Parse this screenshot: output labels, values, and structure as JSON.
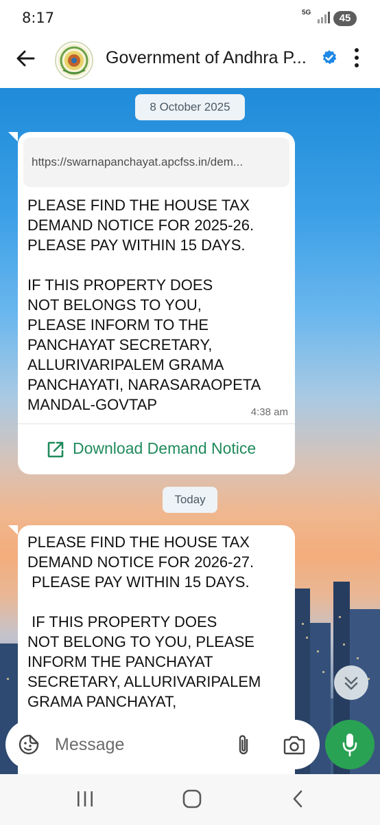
{
  "status_bar": {
    "time": "8:17",
    "network": "5G",
    "battery": "45"
  },
  "header": {
    "title": "Government of Andhra P...",
    "back_icon": "arrow-left-icon",
    "verified_icon": "verified-badge-icon",
    "menu_icon": "more-vertical-icon"
  },
  "messages": [
    {
      "date_chip": "8 October 2025",
      "link": "https://swarnapanchayat.apcfss.in/dem...",
      "text": "PLEASE FIND THE HOUSE TAX\nDEMAND NOTICE FOR 2025-26.\nPLEASE PAY WITHIN 15 DAYS.\n\nIF THIS PROPERTY DOES\nNOT BELONGS TO YOU,\nPLEASE INFORM TO THE\nPANCHAYAT SECRETARY,\nALLURIVARIPALEM GRAMA\nPANCHAYATI, NARASARAOPETA\nMANDAL-GOVTAP",
      "time": "4:38 am",
      "action_label": "Download Demand Notice",
      "action_icon": "external-link-icon"
    },
    {
      "date_chip": "Today",
      "text": "PLEASE FIND THE HOUSE TAX\nDEMAND NOTICE FOR 2026-27.\n PLEASE PAY WITHIN 15 DAYS.\n\n IF THIS PROPERTY DOES\nNOT BELONG TO YOU, PLEASE\nINFORM THE PANCHAYAT\nSECRETARY, ALLURIVARIPALEM\nGRAMA PANCHAYAT,"
    }
  ],
  "composer": {
    "placeholder": "Message",
    "sticker_icon": "sticker-icon",
    "attach_icon": "paperclip-icon",
    "camera_icon": "camera-icon",
    "mic_icon": "mic-icon"
  },
  "scroll_button_icon": "chevrons-down-icon",
  "nav_bar": {
    "recents_icon": "recents-icon",
    "home_icon": "home-icon",
    "back_icon": "back-chevron-icon"
  },
  "colors": {
    "accent_green": "#1f8a5b",
    "mic_green": "#2aa254",
    "verified_blue": "#1e88e5"
  }
}
